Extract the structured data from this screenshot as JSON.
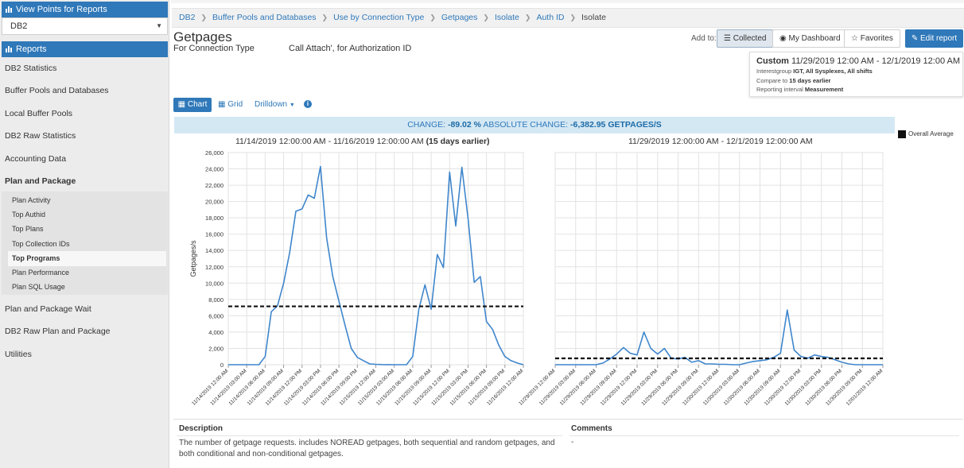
{
  "sidebar": {
    "view_points_header": "View Points for Reports",
    "db_select_value": "DB2",
    "reports_header": "Reports",
    "items": [
      "DB2 Statistics",
      "Buffer Pools and Databases",
      "Local Buffer Pools",
      "DB2 Raw Statistics",
      "Accounting Data",
      "Plan and Package"
    ],
    "sub_items": [
      "Plan Activity",
      "Top Authid",
      "Top Plans",
      "Top Collection IDs",
      "Top Programs",
      "Plan Performance",
      "Plan SQL Usage"
    ],
    "active_sub_item": "Top Programs",
    "items_after": [
      "Plan and Package Wait",
      "DB2 Raw Plan and Package",
      "Utilities"
    ]
  },
  "breadcrumb": [
    "DB2",
    "Buffer Pools and Databases",
    "Use by Connection Type",
    "Getpages",
    "Isolate",
    "Auth ID",
    "Isolate"
  ],
  "page": {
    "title": "Getpages",
    "subtitle_left": "For Connection Type",
    "subtitle_right": "Call Attach', for Authorization ID"
  },
  "toolbar": {
    "add_to_label": "Add to:",
    "collected": "Collected",
    "my_dashboard": "My Dashboard",
    "favorites": "Favorites",
    "edit_report": "Edit report"
  },
  "custom_box": {
    "label": "Custom",
    "range": "11/29/2019 12:00 AM - 12/1/2019 12:00 AM",
    "line1_prefix": "Interestgroup",
    "line1_values": "IGT, All Sysplexes, All shifts",
    "line2_prefix": "Compare to",
    "line2_value": "15 days earlier",
    "line3_prefix": "Reporting interval",
    "line3_value": "Measurement"
  },
  "view_toolbar": {
    "chart": "Chart",
    "grid": "Grid",
    "drilldown": "Drilldown",
    "info_icon": "i"
  },
  "change_bar": {
    "change_label": "CHANGE:",
    "change_value": "-89.02 %",
    "abs_label": "ABSOLUTE CHANGE:",
    "abs_value": "-6,382.95 GETPAGES/S"
  },
  "legend": {
    "label": "Overall Average",
    "color": "#111111"
  },
  "description": {
    "heading": "Description",
    "text": "The number of getpage requests. includes NOREAD getpages, both sequential and random getpages, and both conditional and non-conditional getpages.",
    "comments_heading": "Comments",
    "comments_text": "-"
  },
  "colors": {
    "accent": "#2f78b9",
    "line": "#3f86cc",
    "average": "#111111"
  },
  "chart_data": [
    {
      "type": "line",
      "title": "11/14/2019 12:00:00 AM - 11/16/2019 12:00:00 AM",
      "title_suffix": "(15 days earlier)",
      "ylabel": "Getpages/s",
      "ylim": [
        0,
        26000
      ],
      "yticks": [
        "0",
        "2,000",
        "4,000",
        "6,000",
        "8,000",
        "10,000",
        "12,000",
        "14,000",
        "16,000",
        "18,000",
        "20,000",
        "22,000",
        "24,000",
        "26,000"
      ],
      "grid": true,
      "average": 7150,
      "xticks": [
        "11/14/2019 12:00 AM",
        "11/14/2019 03:00 AM",
        "11/14/2019 06:00 AM",
        "11/14/2019 09:00 AM",
        "11/14/2019 12:00 PM",
        "11/14/2019 03:00 PM",
        "11/14/2019 06:00 PM",
        "11/14/2019 09:00 PM",
        "11/15/2019 12:00 AM",
        "11/15/2019 03:00 AM",
        "11/15/2019 06:00 AM",
        "11/15/2019 09:00 AM",
        "11/15/2019 12:00 PM",
        "11/15/2019 03:00 PM",
        "11/15/2019 06:00 PM",
        "11/15/2019 09:00 PM",
        "11/16/2019 12:00 AM"
      ],
      "x_hours": [
        0,
        1,
        2,
        3,
        4,
        5,
        6,
        7,
        8,
        9,
        10,
        11,
        12,
        13,
        14,
        15,
        16,
        17,
        18,
        19,
        20,
        21,
        22,
        23,
        24,
        25,
        26,
        27,
        28,
        29,
        30,
        31,
        32,
        33,
        34,
        35,
        36,
        37,
        38,
        39,
        40,
        41,
        42,
        43,
        44,
        45,
        46,
        47,
        48
      ],
      "values": [
        0,
        0,
        0,
        0,
        0,
        0,
        1000,
        6500,
        7200,
        10000,
        13800,
        18800,
        19100,
        20800,
        20400,
        24300,
        15500,
        10800,
        7800,
        4800,
        2000,
        900,
        500,
        100,
        50,
        20,
        10,
        0,
        0,
        0,
        1000,
        6800,
        9800,
        6800,
        13500,
        11900,
        23600,
        17000,
        24200,
        18000,
        10100,
        10800,
        5300,
        4300,
        2400,
        1000,
        500,
        200,
        0
      ]
    },
    {
      "type": "line",
      "title": "11/29/2019 12:00:00 AM - 12/1/2019 12:00:00 AM",
      "ylabel": "",
      "ylim": [
        0,
        26000
      ],
      "grid": true,
      "average": 780,
      "xticks": [
        "11/29/2019 12:00 AM",
        "11/29/2019 03:00 AM",
        "11/29/2019 06:00 AM",
        "11/29/2019 09:00 AM",
        "11/29/2019 12:00 PM",
        "11/29/2019 03:00 PM",
        "11/29/2019 06:00 PM",
        "11/29/2019 09:00 PM",
        "11/30/2019 12:00 AM",
        "11/30/2019 03:00 AM",
        "11/30/2019 06:00 AM",
        "11/30/2019 09:00 AM",
        "11/30/2019 12:00 PM",
        "11/30/2019 03:00 PM",
        "11/30/2019 06:00 PM",
        "11/30/2019 09:00 PM",
        "12/01/2019 12:00 AM"
      ],
      "x_hours": [
        0,
        1,
        2,
        3,
        4,
        5,
        6,
        7,
        8,
        9,
        10,
        11,
        12,
        13,
        14,
        15,
        16,
        17,
        18,
        19,
        20,
        21,
        22,
        23,
        24,
        25,
        26,
        27,
        28,
        29,
        30,
        31,
        32,
        33,
        34,
        35,
        36,
        37,
        38,
        39,
        40,
        41,
        42,
        43,
        44,
        45,
        46,
        47,
        48
      ],
      "values": [
        0,
        0,
        0,
        0,
        0,
        0,
        0,
        200,
        700,
        1300,
        2100,
        1400,
        1200,
        4000,
        2000,
        1300,
        2000,
        800,
        700,
        900,
        300,
        500,
        100,
        100,
        50,
        50,
        0,
        0,
        200,
        400,
        500,
        600,
        900,
        1400,
        6700,
        1800,
        1000,
        800,
        1200,
        1000,
        900,
        600,
        300,
        100,
        0,
        0,
        0,
        0,
        0
      ]
    }
  ]
}
